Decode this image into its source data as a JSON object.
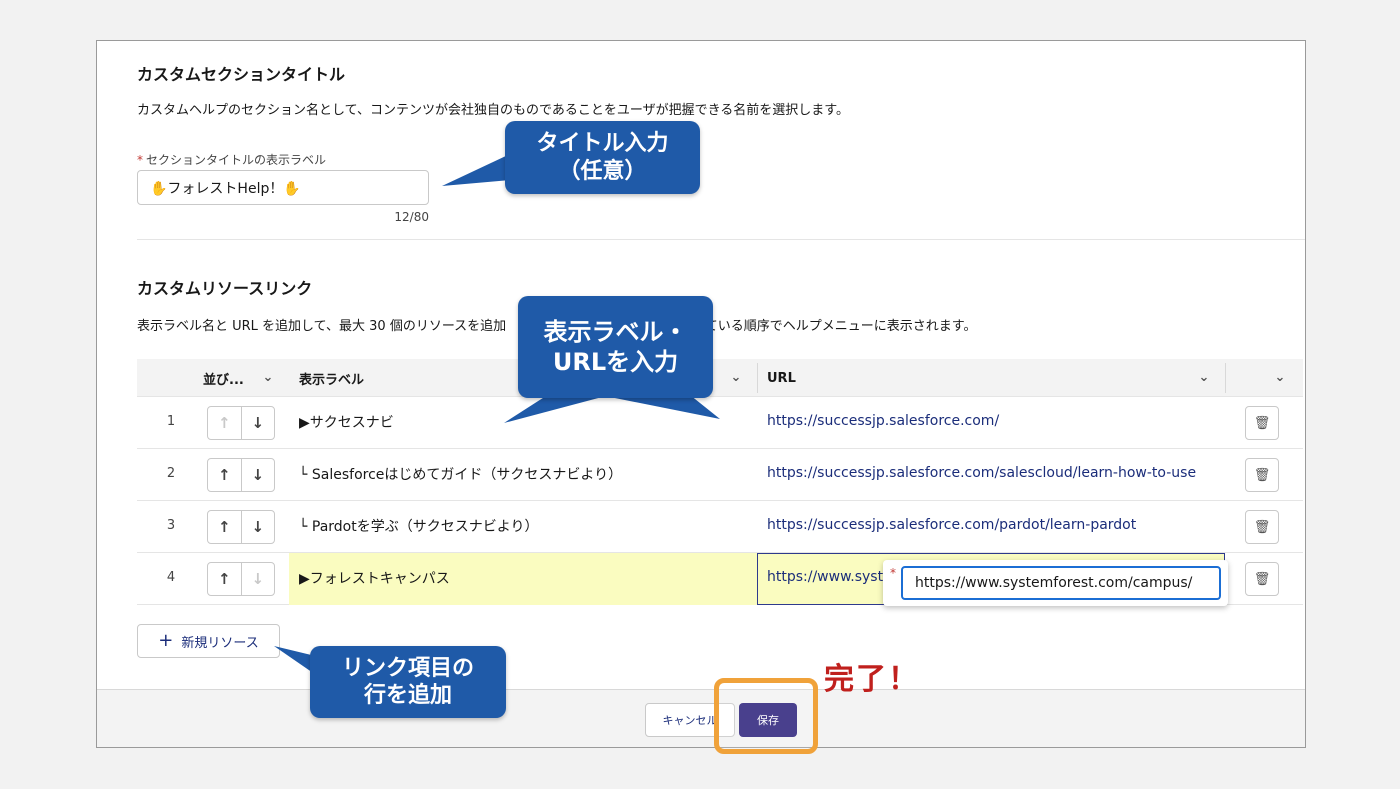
{
  "section1": {
    "title": "カスタムセクションタイトル",
    "description": "カスタムヘルプのセクション名として、コンテンツが会社独自のものであることをユーザが把握できる名前を選択します。",
    "field_label": "セクションタイトルの表示ラベル",
    "required_mark": "*",
    "input_value": "✋フォレストHelp！✋",
    "counter": "12/80"
  },
  "section2": {
    "title": "カスタムリソースリンク",
    "description": "表示ラベル名と URL を追加して、最大 30 個のリソースを追加",
    "description_tail": "れている順序でヘルプメニューに表示されます。"
  },
  "table": {
    "headers": {
      "order": "並び...",
      "label": "表示ラベル",
      "url": "URL"
    },
    "rows": [
      {
        "num": "1",
        "label": "▶サクセスナビ",
        "url": "https://successjp.salesforce.com/"
      },
      {
        "num": "2",
        "label": "└ Salesforceはじめてガイド（サクセスナビより）",
        "url": "https://successjp.salesforce.com/salescloud/learn-how-to-use"
      },
      {
        "num": "3",
        "label": "└ Pardotを学ぶ（サクセスナビより）",
        "url": "https://successjp.salesforce.com/pardot/learn-pardot"
      },
      {
        "num": "4",
        "label": "▶フォレストキャンパス",
        "url": "https://www.syste"
      }
    ],
    "edit_popover_value": "https://www.systemforest.com/campus/"
  },
  "buttons": {
    "new_resource": "新規リソース",
    "cancel": "キャンセル",
    "save": "保存"
  },
  "callouts": {
    "title_input_line1": "タイトル入力",
    "title_input_line2": "（任意）",
    "label_url_line1": "表示ラベル・",
    "label_url_line2": "URLを入力",
    "add_row_line1": "リンク項目の",
    "add_row_line2": "行を追加",
    "done": "完了！"
  },
  "colors": {
    "callout_blue": "#1f5aa8",
    "save_purple": "#2a1f7a",
    "highlight_orange": "#f0a23a",
    "done_red": "#c0201d",
    "edit_yellow": "#fafcc0"
  }
}
